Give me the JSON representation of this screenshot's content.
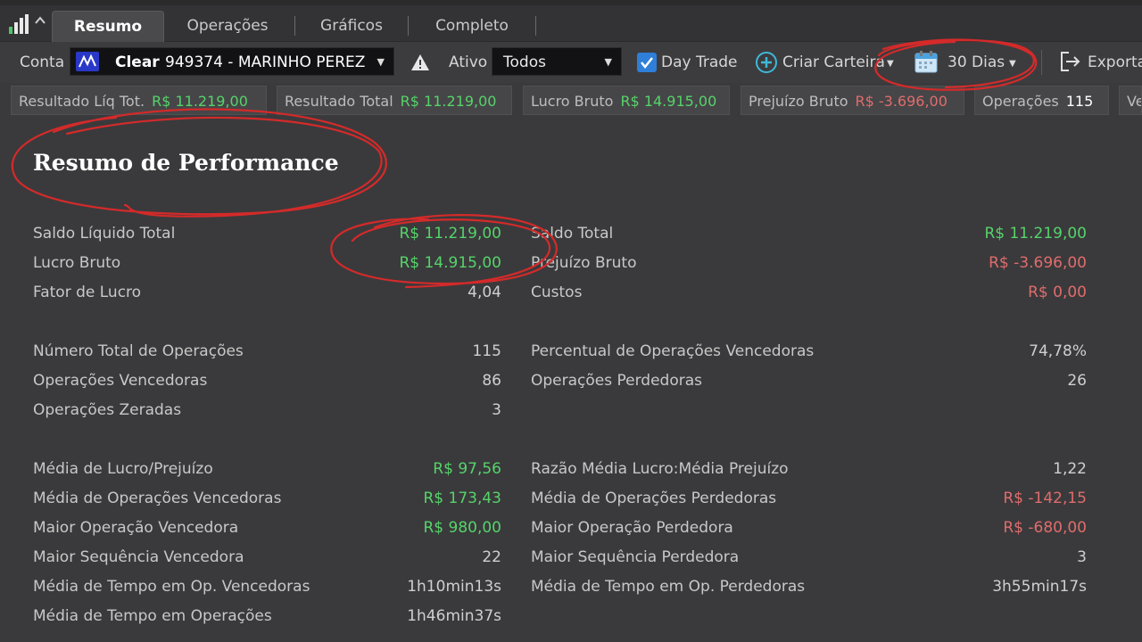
{
  "tabs": [
    {
      "label": "Resumo",
      "active": true
    },
    {
      "label": "Operações",
      "active": false
    },
    {
      "label": "Gráficos",
      "active": false
    },
    {
      "label": "Completo",
      "active": false
    }
  ],
  "toolbar": {
    "conta_label": "Conta",
    "account_broker": "Clear",
    "account_name": "949374 - MARINHO PEREZ",
    "ativo_label": "Ativo",
    "ativo_value": "Todos",
    "day_trade_label": "Day Trade",
    "day_trade_checked": true,
    "criar_carteira_label": "Criar Carteira",
    "period_label": "30 Dias",
    "export_label": "Exporta"
  },
  "summary_strip": [
    {
      "label": "Resultado Líq Tot.",
      "value": "R$ 11.219,00",
      "color": "#56d36a"
    },
    {
      "label": "Resultado Total",
      "value": "R$ 11.219,00",
      "color": "#56d36a"
    },
    {
      "label": "Lucro Bruto",
      "value": "R$ 14.915,00",
      "color": "#56d36a"
    },
    {
      "label": "Prejuízo Bruto",
      "value": "R$ -3.696,00",
      "color": "#e06c6c"
    },
    {
      "label": "Operações",
      "value": "115",
      "color": "#ffffff"
    },
    {
      "label": "Ve",
      "value": "",
      "color": "#ffffff"
    }
  ],
  "performance": {
    "title": "Resumo de Performance",
    "left": [
      {
        "label": "Saldo Líquido Total",
        "value": "R$ 11.219,00",
        "tone": "green"
      },
      {
        "label": "Lucro Bruto",
        "value": "R$ 14.915,00",
        "tone": "green"
      },
      {
        "label": "Fator de Lucro",
        "value": "4,04",
        "tone": "neutral"
      },
      {
        "label": "Número Total de Operações",
        "value": "115",
        "tone": "neutral"
      },
      {
        "label": "Operações Vencedoras",
        "value": "86",
        "tone": "neutral"
      },
      {
        "label": "Operações Zeradas",
        "value": "3",
        "tone": "neutral"
      },
      {
        "label": "Média de Lucro/Prejuízo",
        "value": "R$ 97,56",
        "tone": "green"
      },
      {
        "label": "Média de Operações Vencedoras",
        "value": "R$ 173,43",
        "tone": "green"
      },
      {
        "label": "Maior Operação Vencedora",
        "value": "R$ 980,00",
        "tone": "green"
      },
      {
        "label": "Maior Sequência Vencedora",
        "value": "22",
        "tone": "neutral"
      },
      {
        "label": "Média de Tempo em Op. Vencedoras",
        "value": "1h10min13s",
        "tone": "neutral"
      },
      {
        "label": "Média de Tempo em Operações",
        "value": "1h46min37s",
        "tone": "neutral"
      }
    ],
    "right": [
      {
        "label": "Saldo Total",
        "value": "R$ 11.219,00",
        "tone": "green"
      },
      {
        "label": "Prejuízo Bruto",
        "value": "R$ -3.696,00",
        "tone": "red"
      },
      {
        "label": "Custos",
        "value": "R$ 0,00",
        "tone": "red"
      },
      {
        "label": "Percentual de Operações Vencedoras",
        "value": "74,78%",
        "tone": "neutral"
      },
      {
        "label": "Operações Perdedoras",
        "value": "26",
        "tone": "neutral"
      },
      {
        "label": "Razão Média Lucro:Média Prejuízo",
        "value": "1,22",
        "tone": "neutral"
      },
      {
        "label": "Média de Operações Perdedoras",
        "value": "R$ -142,15",
        "tone": "red"
      },
      {
        "label": "Maior Operação Perdedora",
        "value": "R$ -680,00",
        "tone": "red"
      },
      {
        "label": "Maior Sequência Perdedora",
        "value": "3",
        "tone": "neutral"
      },
      {
        "label": "Média de Tempo em Op. Perdedoras",
        "value": "3h55min17s",
        "tone": "neutral"
      }
    ]
  },
  "colors": {
    "positive": "#56d36a",
    "negative": "#e06c6c",
    "annotation": "#d42a2a"
  },
  "icons": [
    "chart-bars-icon",
    "chevron-up-icon",
    "clear-broker-logo-icon",
    "chevron-down-icon",
    "warning-icon",
    "checkbox-checked-icon",
    "plus-circle-icon",
    "calendar-icon",
    "export-icon"
  ]
}
